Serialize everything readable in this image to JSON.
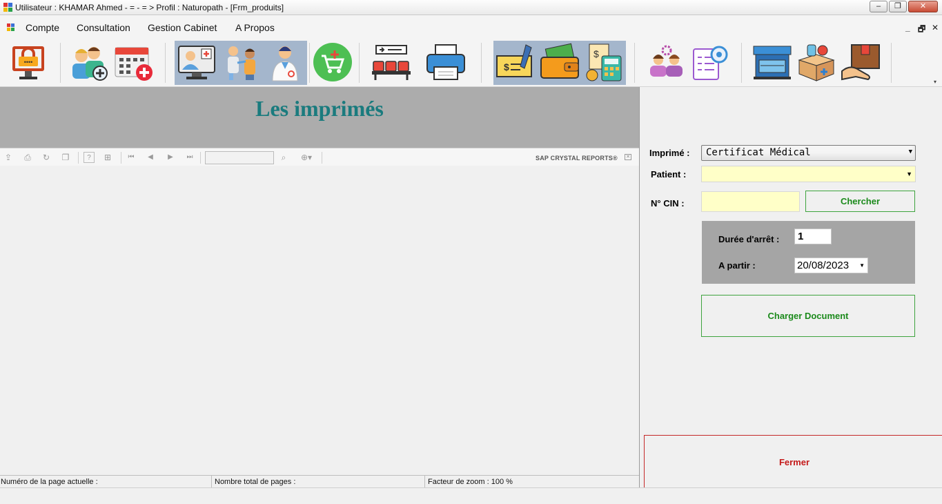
{
  "window": {
    "title": "Utilisateur : KHAMAR  Ahmed - = - = > Profil : Naturopath - [Frm_produits]",
    "minimize_glyph": "–",
    "maximize_glyph": "❐",
    "close_glyph": "✕"
  },
  "menu": {
    "items": [
      "Compte",
      "Consultation",
      "Gestion Cabinet",
      "A Propos"
    ],
    "mdi_min": "_",
    "mdi_restore": "🗗",
    "mdi_close": "✕"
  },
  "toolbar": {
    "icons": [
      "lock-screen-icon",
      "add-patient-icon",
      "calendar-medical-icon",
      "doctor-computer-icon",
      "vaccination-icon",
      "doctor-icon",
      "cart-add-icon",
      "waiting-room-icon",
      "printer-icon",
      "cheque-icon",
      "wallet-icon",
      "accounting-calculator-icon",
      "users-settings-icon",
      "list-settings-icon",
      "pharmacy-store-icon",
      "medicine-box-icon",
      "delivery-box-icon"
    ],
    "highlight_color": "#a4b6cc",
    "overflow_glyph": "▾"
  },
  "report": {
    "title": "Les imprimés",
    "title_color": "#1a7b7e",
    "sap_label": "SAP CRYSTAL REPORTS®",
    "page_number": "",
    "status": {
      "current_page": "Numéro de la page actuelle :",
      "total_pages": "Nombre total de pages :",
      "zoom": "Facteur de zoom : 100 %"
    }
  },
  "form": {
    "imprime_label": "Imprimé :",
    "imprime_value": "Certificat Médical",
    "patient_label": "Patient :",
    "patient_value": "",
    "cin_label": "N° CIN :",
    "cin_value": "",
    "chercher_label": "Chercher",
    "duree_label": "Durée d'arrêt :",
    "duree_value": "1",
    "a_partir_label": "A partir  :",
    "date_value": "20/08/2023",
    "charger_label": "Charger Document",
    "fermer_label": "Fermer"
  }
}
